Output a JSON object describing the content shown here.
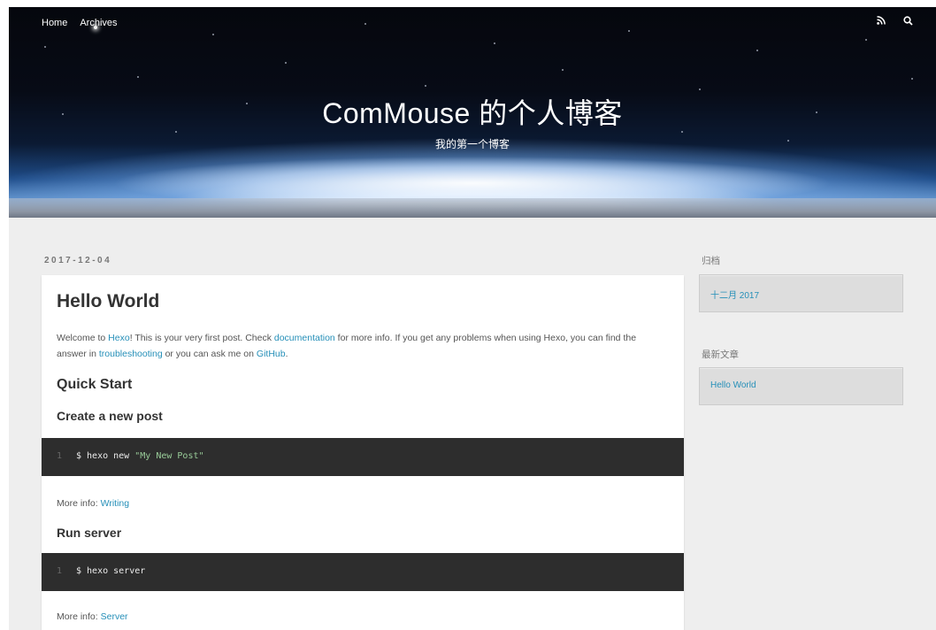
{
  "nav": {
    "home": "Home",
    "archives": "Archives",
    "rss_icon": "rss-icon",
    "search_icon": "search-icon"
  },
  "banner": {
    "title": "ComMouse 的个人博客",
    "subtitle": "我的第一个博客"
  },
  "post": {
    "date": "2017-12-04",
    "title": "Hello World",
    "intro": {
      "t1": "Welcome to ",
      "link_hexo": "Hexo",
      "t2": "! This is your very first post. Check ",
      "link_docs": "documentation",
      "t3": " for more info. If you get any problems when using Hexo, you can find the answer in ",
      "link_troubleshooting": "troubleshooting",
      "t4": " or you can ask me on ",
      "link_github": "GitHub",
      "t5": "."
    },
    "quick_start": "Quick Start",
    "section1": {
      "heading": "Create a new post",
      "line_no": "1",
      "cmd_prefix": "$ hexo new ",
      "cmd_string": "\"My New Post\"",
      "more_label": "More info: ",
      "more_link": "Writing"
    },
    "section2": {
      "heading": "Run server",
      "line_no": "1",
      "cmd": "$ hexo server",
      "more_label": "More info: ",
      "more_link": "Server"
    }
  },
  "sidebar": {
    "archive_title": "归档",
    "archive_item": "十二月 2017",
    "recent_title": "最新文章",
    "recent_item": "Hello World"
  },
  "colors": {
    "link": "#258fb8",
    "code_bg": "#2d2d2d",
    "code_string": "#99cc99",
    "page_bg": "#eeeeee"
  }
}
